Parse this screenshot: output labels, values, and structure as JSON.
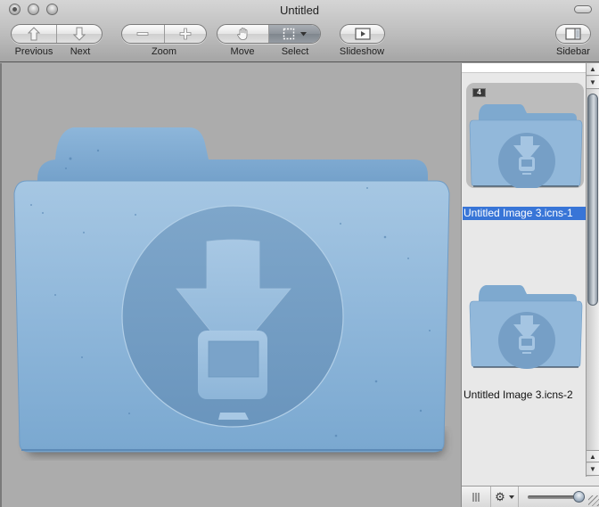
{
  "window": {
    "title": "Untitled"
  },
  "toolbar": {
    "previous_label": "Previous",
    "next_label": "Next",
    "zoom_label": "Zoom",
    "move_label": "Move",
    "select_label": "Select",
    "slideshow_label": "Slideshow",
    "sidebar_label": "Sidebar",
    "active_tool": "select"
  },
  "canvas": {
    "document": "download-folder-icon"
  },
  "sidebar": {
    "items": [
      {
        "label": "Untitled Image 3.icns-1",
        "badge": "4",
        "selected": true
      },
      {
        "label": "Untitled Image 3.icns-2",
        "selected": false
      }
    ],
    "thumbnail_size": 0.9
  },
  "colors": {
    "selection": "#3875d7",
    "folder_blue": "#7fa9cf"
  }
}
